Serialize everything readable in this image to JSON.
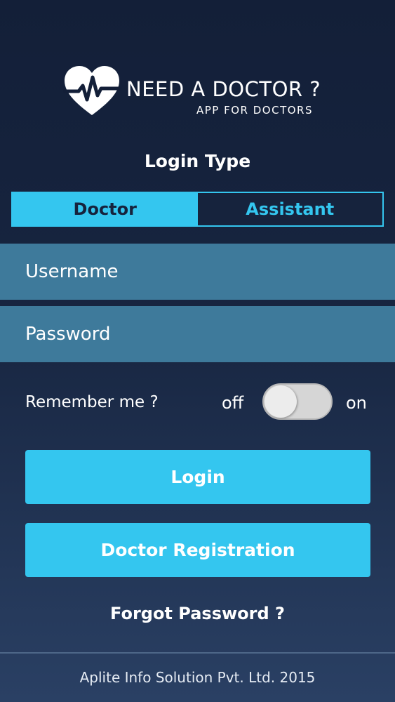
{
  "app": {
    "title": "NEED A DOCTOR ?",
    "subtitle": "APP FOR DOCTORS",
    "logo_icon": "heart-pulse-icon"
  },
  "login": {
    "type_label": "Login Type",
    "types": [
      {
        "label": "Doctor",
        "active": true
      },
      {
        "label": "Assistant",
        "active": false
      }
    ],
    "username_placeholder": "Username",
    "password_placeholder": "Password",
    "remember_label": "Remember me ?",
    "toggle_off_label": "off",
    "toggle_on_label": "on",
    "remember_enabled": false,
    "login_button": "Login",
    "register_button": "Doctor Registration",
    "forgot_link": "Forgot Password ?"
  },
  "footer": {
    "text": "Aplite Info Solution Pvt. Ltd. 2015"
  },
  "colors": {
    "accent": "#34c6ef",
    "background_top": "#131f38",
    "background_bottom": "#2a4064",
    "field_background": "#3e7a9b"
  }
}
